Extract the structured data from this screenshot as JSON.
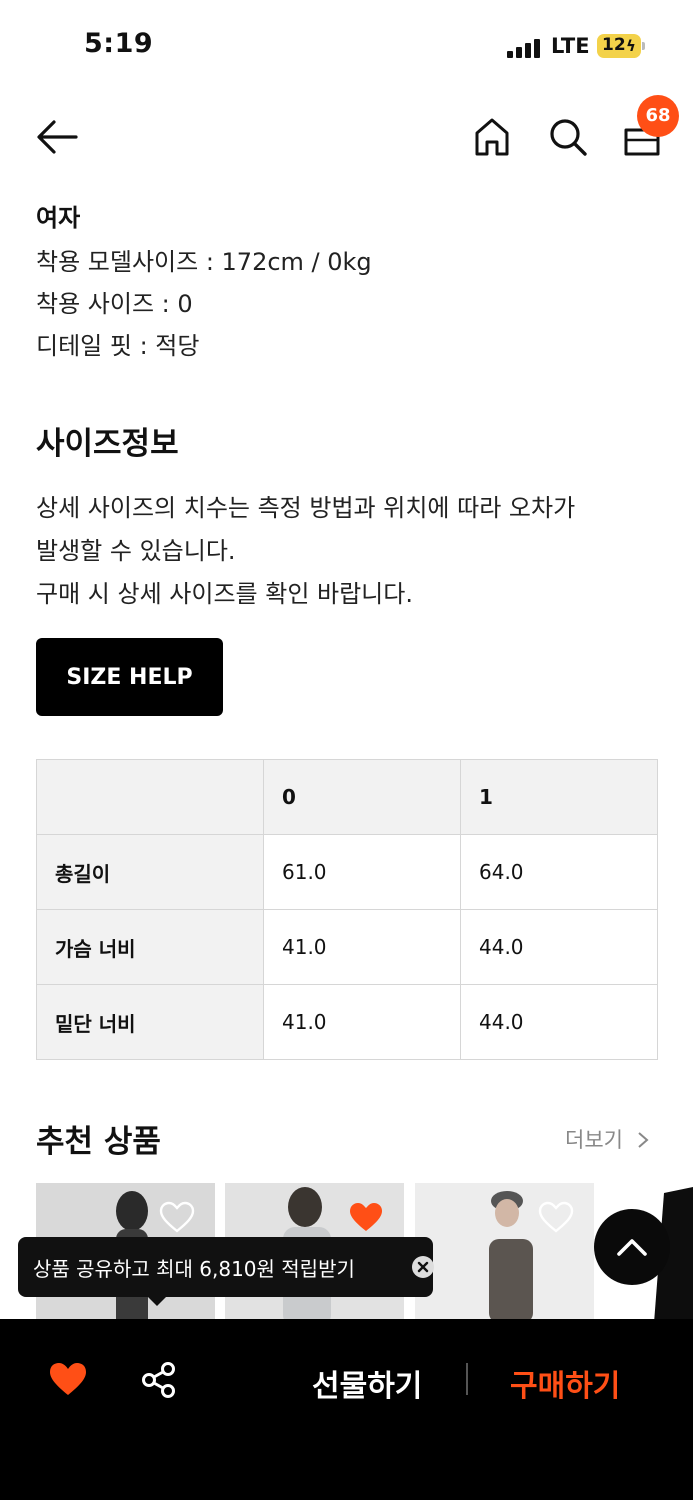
{
  "status_bar": {
    "time": "5:19",
    "network": "LTE",
    "battery": "12"
  },
  "header": {
    "cart_count": "68"
  },
  "model_info": {
    "gender": "여자",
    "lines": [
      "착용 모델사이즈 : 172cm / 0kg",
      "착용 사이즈 : 0",
      "디테일 핏 : 적당"
    ]
  },
  "size_info": {
    "title": "사이즈정보",
    "description": [
      "상세 사이즈의 치수는 측정 방법과 위치에 따라 오차가",
      "발생할 수 있습니다.",
      "구매 시 상세 사이즈를 확인 바랍니다."
    ],
    "size_help_label": "SIZE HELP",
    "table": {
      "columns": [
        "",
        "0",
        "1"
      ],
      "rows": [
        {
          "label": "총길이",
          "values": [
            "61.0",
            "64.0"
          ]
        },
        {
          "label": "가슴 너비",
          "values": [
            "41.0",
            "44.0"
          ]
        },
        {
          "label": "밑단 너비",
          "values": [
            "41.0",
            "44.0"
          ]
        }
      ]
    }
  },
  "recommended": {
    "title": "추천 상품",
    "more_label": "더보기"
  },
  "tooltip": {
    "text": "상품 공유하고 최대 6,810원 적립받기"
  },
  "bottom_bar": {
    "gift_label": "선물하기",
    "buy_label": "구매하기"
  },
  "colors": {
    "accent": "#ff4f16",
    "background": "#ffffff",
    "bar": "#000000"
  }
}
